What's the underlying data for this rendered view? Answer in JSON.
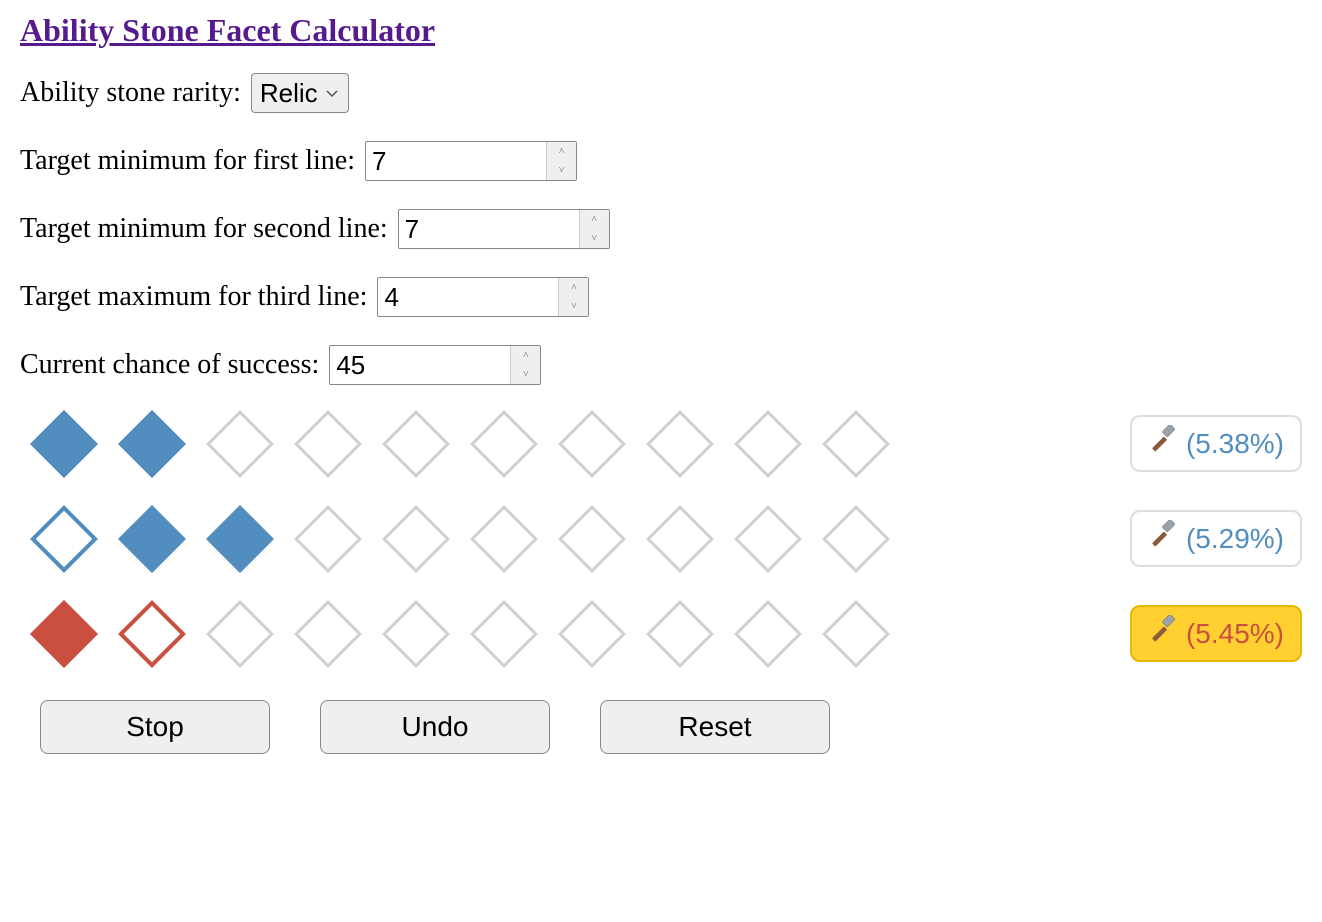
{
  "title": "Ability Stone Facet Calculator",
  "form": {
    "rarity_label": "Ability stone rarity:",
    "rarity_value": "Relic",
    "target1_label": "Target minimum for first line:",
    "target1_value": "7",
    "target2_label": "Target minimum for second line:",
    "target2_value": "7",
    "target3_label": "Target maximum for third line:",
    "target3_value": "4",
    "chance_label": "Current chance of success:",
    "chance_value": "45"
  },
  "lines": [
    {
      "color": "blue",
      "slots": [
        "fill",
        "fill",
        "empty",
        "empty",
        "empty",
        "empty",
        "empty",
        "empty",
        "empty",
        "empty"
      ],
      "percent": "(5.38%)",
      "highlighted": false
    },
    {
      "color": "blue",
      "slots": [
        "miss",
        "fill",
        "fill",
        "empty",
        "empty",
        "empty",
        "empty",
        "empty",
        "empty",
        "empty"
      ],
      "percent": "(5.29%)",
      "highlighted": false
    },
    {
      "color": "red",
      "slots": [
        "fill",
        "miss",
        "empty",
        "empty",
        "empty",
        "empty",
        "empty",
        "empty",
        "empty",
        "empty"
      ],
      "percent": "(5.45%)",
      "highlighted": true
    }
  ],
  "buttons": {
    "stop": "Stop",
    "undo": "Undo",
    "reset": "Reset"
  }
}
